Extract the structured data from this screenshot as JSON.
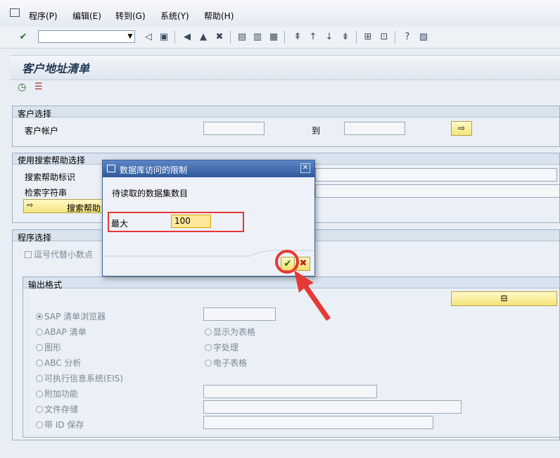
{
  "menu": {
    "items": [
      "程序(P)",
      "编辑(E)",
      "转到(G)",
      "系统(Y)",
      "帮助(H)"
    ]
  },
  "toolbar": {
    "command_value": "",
    "icons": [
      "enter-icon",
      "back-icon",
      "save-icon",
      "back-nav-icon",
      "exit-icon",
      "cancel-icon",
      "print-icon",
      "find-icon",
      "find-next-icon",
      "first-page-icon",
      "prev-page-icon",
      "next-page-icon",
      "last-page-icon",
      "new-session-icon",
      "shortcut-icon",
      "help-icon",
      "layout-icon"
    ]
  },
  "page": {
    "title": "客户地址清单"
  },
  "customer_selection": {
    "heading": "客户选择",
    "account_label": "客户帐户",
    "to_label": "到",
    "from_value": "",
    "to_value": ""
  },
  "search_help": {
    "heading": "使用搜索帮助选择",
    "id_label": "搜索帮助标识",
    "string_label": "检索字符串",
    "button_label": "搜索帮助"
  },
  "program_selection": {
    "heading": "程序选择",
    "comma_decimal_label": "逗号代替小数点"
  },
  "output_format": {
    "heading": "输出格式",
    "options_left": [
      "SAP 清单浏览器",
      "ABAP 清单",
      "图形",
      "ABC 分析",
      "可执行信息系统(EIS)",
      "附加功能",
      "文件存储",
      "带 ID 保存"
    ],
    "options_right": [
      "显示为表格",
      "字处理",
      "电子表格"
    ],
    "selected": "SAP 清单浏览器"
  },
  "dialog": {
    "title": "数据库访问的限制",
    "prompt": "待读取的数据集数目",
    "max_label": "最大",
    "max_value": "100"
  },
  "colors": {
    "highlight_red": "#e53935",
    "dialog_title_blue": "#2f5a9e",
    "button_yellow": "#f5e37a"
  }
}
